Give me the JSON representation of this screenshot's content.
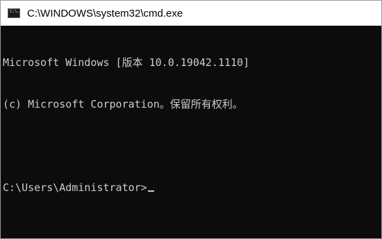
{
  "window": {
    "title": "C:\\WINDOWS\\system32\\cmd.exe",
    "icon": "cmd-icon",
    "icon_text": "C:\\."
  },
  "console": {
    "lines": [
      "Microsoft Windows [版本 10.0.19042.1110]",
      "(c) Microsoft Corporation。保留所有权利。",
      "",
      "C:\\Users\\Administrator>"
    ]
  },
  "colors": {
    "background": "#0c0c0c",
    "foreground": "#cccccc",
    "titlebar": "#ffffff"
  }
}
